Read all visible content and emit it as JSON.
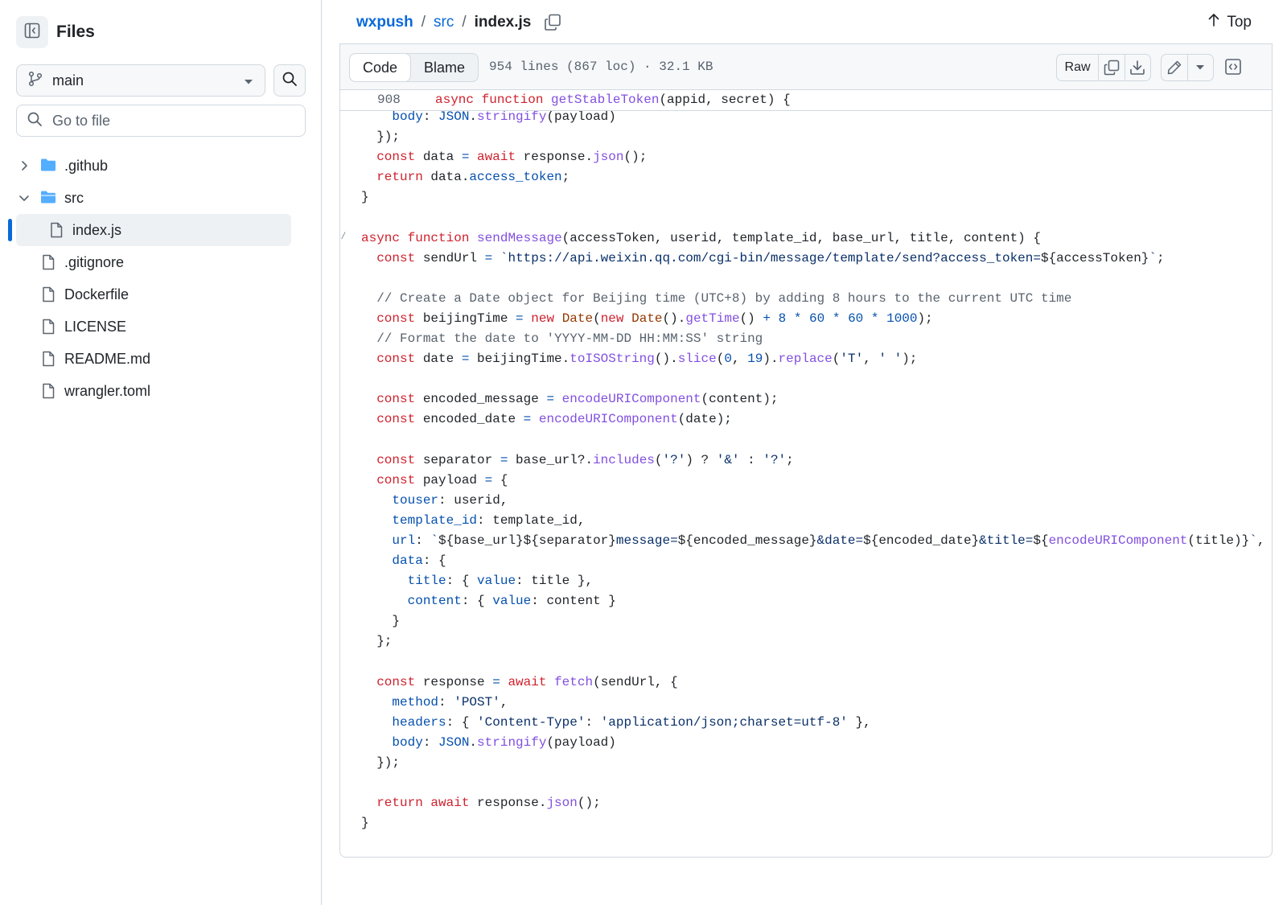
{
  "sidebar": {
    "title": "Files",
    "branch": "main",
    "goto_placeholder": "Go to file",
    "tree": [
      {
        "name": ".github",
        "type": "folder",
        "expanded": false
      },
      {
        "name": "src",
        "type": "folder",
        "expanded": true
      },
      {
        "name": "index.js",
        "type": "file",
        "selected": true
      },
      {
        "name": ".gitignore",
        "type": "file"
      },
      {
        "name": "Dockerfile",
        "type": "file"
      },
      {
        "name": "LICENSE",
        "type": "file"
      },
      {
        "name": "README.md",
        "type": "file"
      },
      {
        "name": "wrangler.toml",
        "type": "file"
      }
    ]
  },
  "breadcrumb": {
    "repo": "wxpush",
    "folder": "src",
    "file": "index.js",
    "sep": "/"
  },
  "top_label": "Top",
  "toolbar": {
    "code_tab": "Code",
    "blame_tab": "Blame",
    "meta": "954 lines (867 loc) · 32.1 KB",
    "raw_label": "Raw"
  },
  "sticky": {
    "line_number": "908",
    "text": "async function getStableToken(appid, secret) {"
  },
  "code": [
    "    body: JSON.stringify(payload)",
    "  });",
    "  const data = await response.json();",
    "  return data.access_token;",
    "}",
    "",
    "async function sendMessage(accessToken, userid, template_id, base_url, title, content) {",
    "  const sendUrl = `https://api.weixin.qq.com/cgi-bin/message/template/send?access_token=${accessToken}`;",
    "",
    "  // Create a Date object for Beijing time (UTC+8) by adding 8 hours to the current UTC time",
    "  const beijingTime = new Date(new Date().getTime() + 8 * 60 * 60 * 1000);",
    "  // Format the date to 'YYYY-MM-DD HH:MM:SS' string",
    "  const date = beijingTime.toISOString().slice(0, 19).replace('T', ' ');",
    "",
    "  const encoded_message = encodeURIComponent(content);",
    "  const encoded_date = encodeURIComponent(date);",
    "",
    "  const separator = base_url?.includes('?') ? '&' : '?';",
    "  const payload = {",
    "    touser: userid,",
    "    template_id: template_id,",
    "    url: `${base_url}${separator}message=${encoded_message}&date=${encoded_date}&title=${encodeURIComponent(title)}`,",
    "    data: {",
    "      title: { value: title },",
    "      content: { value: content }",
    "    }",
    "  };",
    "",
    "  const response = await fetch(sendUrl, {",
    "    method: 'POST',",
    "    headers: { 'Content-Type': 'application/json;charset=utf-8' },",
    "    body: JSON.stringify(payload)",
    "  });",
    "",
    "  return await response.json();",
    "}"
  ],
  "colors": {
    "link": "#0969da",
    "keyword": "#cf222e",
    "function": "#8250df",
    "string": "#0a3069",
    "comment": "#59636e",
    "number": "#0550ae",
    "border": "#d1d9e0"
  },
  "icons": {
    "sidebar_toggle": "sidebar-collapse-icon",
    "branch": "git-branch-icon",
    "search": "search-icon",
    "folder": "folder-icon",
    "file": "file-icon",
    "copy": "copy-icon",
    "download": "download-icon",
    "edit": "pencil-icon",
    "symbols": "code-square-icon",
    "top": "arrow-up-icon"
  }
}
